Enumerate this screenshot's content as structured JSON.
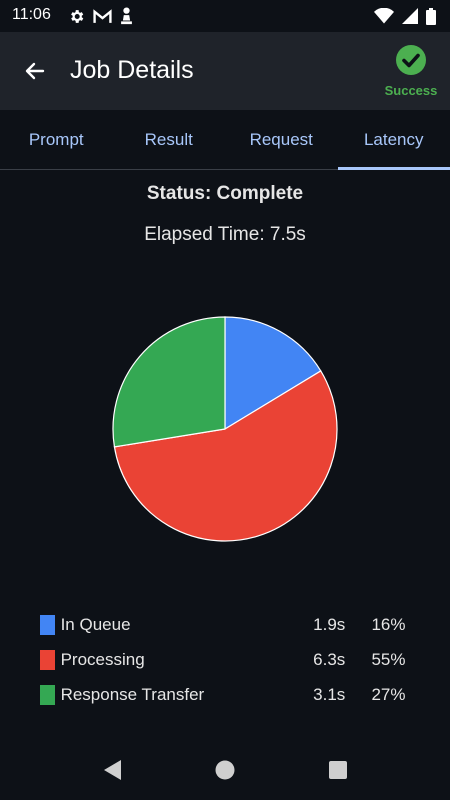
{
  "status_bar": {
    "time": "11:06",
    "left_icons": [
      "gear-icon",
      "gmail-icon",
      "chess-pawn-icon"
    ],
    "right_icons": [
      "wifi-icon",
      "signal-icon",
      "battery-icon"
    ]
  },
  "app_bar": {
    "title": "Job Details",
    "badge_label": "Success",
    "badge_color": "#4caf50",
    "background": "#1f232a"
  },
  "tabs": [
    {
      "label": "Prompt",
      "active": false
    },
    {
      "label": "Result",
      "active": false
    },
    {
      "label": "Request",
      "active": false
    },
    {
      "label": "Latency",
      "active": true
    }
  ],
  "summary": {
    "status": "Status: Complete",
    "elapsed": "Elapsed Time: 7.5s"
  },
  "chart_data": {
    "type": "pie",
    "categories": [
      "In Queue",
      "Processing",
      "Response Transfer"
    ],
    "values": [
      16,
      55,
      27
    ],
    "times": [
      "1.9s",
      "6.3s",
      "3.1s"
    ],
    "percent_labels": [
      "16%",
      "55%",
      "27%"
    ],
    "colors": [
      "#4285f4",
      "#ea4335",
      "#34a853"
    ],
    "legend_position": "bottom"
  },
  "nav": {
    "back": "back-triangle-icon",
    "home": "home-circle-icon",
    "recents": "recents-square-icon"
  }
}
